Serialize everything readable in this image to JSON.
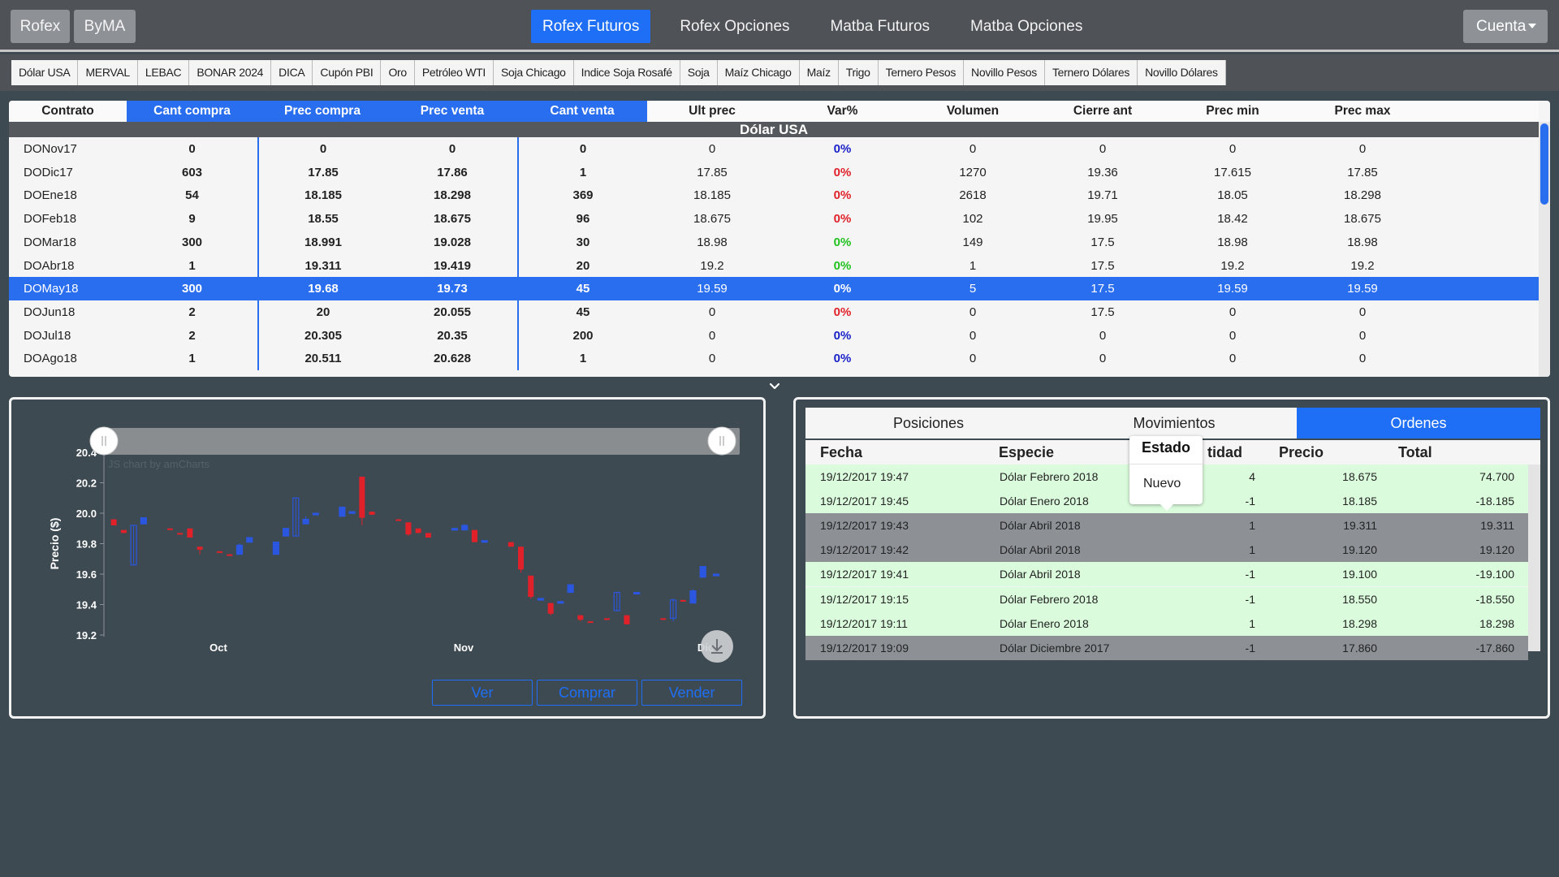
{
  "colors": {
    "page_bg": "#3d4a52",
    "nav_bg": "#4f5256",
    "accent": "#1e6ff5",
    "up": "#e0212a",
    "down": "#2a56e0",
    "var_zero": "#1a22c8",
    "var_green": "#21c11e",
    "row_green": "#dbfcdc",
    "row_gray": "#8d9196"
  },
  "topnav": {
    "markets": [
      "Rofex",
      "ByMA"
    ],
    "links": [
      {
        "label": "Rofex Futuros",
        "active": true
      },
      {
        "label": "Rofex Opciones",
        "active": false
      },
      {
        "label": "Matba Futuros",
        "active": false
      },
      {
        "label": "Matba Opciones",
        "active": false
      }
    ],
    "account_label": "Cuenta",
    "account_icon": "caret-down-icon"
  },
  "instruments": [
    "Dólar USA",
    "MERVAL",
    "LEBAC",
    "BONAR 2024",
    "DICA",
    "Cupón PBI",
    "Oro",
    "Petróleo WTI",
    "Soja Chicago",
    "Indice Soja Rosafé",
    "Soja",
    "Maíz Chicago",
    "Maíz",
    "Trigo",
    "Ternero Pesos",
    "Novillo Pesos",
    "Ternero Dólares",
    "Novillo Dólares"
  ],
  "market_table": {
    "columns": [
      "Contrato",
      "Cant compra",
      "Prec compra",
      "Prec venta",
      "Cant venta",
      "Ult prec",
      "Var%",
      "Volumen",
      "Cierre ant",
      "Prec min",
      "Prec max"
    ],
    "section_title": "Dólar USA",
    "selected_row": "DOMay18",
    "rows": [
      {
        "contrato": "DONov17",
        "cant_compra": "0",
        "prec_compra": "0",
        "prec_venta": "0",
        "cant_venta": "0",
        "ult_prec": "0",
        "var": "0%",
        "var_color": "blue",
        "volumen": "0",
        "cierre_ant": "0",
        "prec_min": "0",
        "prec_max": "0"
      },
      {
        "contrato": "DODic17",
        "cant_compra": "603",
        "prec_compra": "17.85",
        "prec_venta": "17.86",
        "cant_venta": "1",
        "ult_prec": "17.85",
        "var": "0%",
        "var_color": "red",
        "volumen": "1270",
        "cierre_ant": "19.36",
        "prec_min": "17.615",
        "prec_max": "17.85"
      },
      {
        "contrato": "DOEne18",
        "cant_compra": "54",
        "prec_compra": "18.185",
        "prec_venta": "18.298",
        "cant_venta": "369",
        "ult_prec": "18.185",
        "var": "0%",
        "var_color": "red",
        "volumen": "2618",
        "cierre_ant": "19.71",
        "prec_min": "18.05",
        "prec_max": "18.298"
      },
      {
        "contrato": "DOFeb18",
        "cant_compra": "9",
        "prec_compra": "18.55",
        "prec_venta": "18.675",
        "cant_venta": "96",
        "ult_prec": "18.675",
        "var": "0%",
        "var_color": "red",
        "volumen": "102",
        "cierre_ant": "19.95",
        "prec_min": "18.42",
        "prec_max": "18.675"
      },
      {
        "contrato": "DOMar18",
        "cant_compra": "300",
        "prec_compra": "18.991",
        "prec_venta": "19.028",
        "cant_venta": "30",
        "ult_prec": "18.98",
        "var": "0%",
        "var_color": "green",
        "volumen": "149",
        "cierre_ant": "17.5",
        "prec_min": "18.98",
        "prec_max": "18.98"
      },
      {
        "contrato": "DOAbr18",
        "cant_compra": "1",
        "prec_compra": "19.311",
        "prec_venta": "19.419",
        "cant_venta": "20",
        "ult_prec": "19.2",
        "var": "0%",
        "var_color": "green",
        "volumen": "1",
        "cierre_ant": "17.5",
        "prec_min": "19.2",
        "prec_max": "19.2"
      },
      {
        "contrato": "DOMay18",
        "cant_compra": "300",
        "prec_compra": "19.68",
        "prec_venta": "19.73",
        "cant_venta": "45",
        "ult_prec": "19.59",
        "var": "0%",
        "var_color": "green",
        "volumen": "5",
        "cierre_ant": "17.5",
        "prec_min": "19.59",
        "prec_max": "19.59"
      },
      {
        "contrato": "DOJun18",
        "cant_compra": "2",
        "prec_compra": "20",
        "prec_venta": "20.055",
        "cant_venta": "45",
        "ult_prec": "0",
        "var": "0%",
        "var_color": "red",
        "volumen": "0",
        "cierre_ant": "17.5",
        "prec_min": "0",
        "prec_max": "0"
      },
      {
        "contrato": "DOJul18",
        "cant_compra": "2",
        "prec_compra": "20.305",
        "prec_venta": "20.35",
        "cant_venta": "200",
        "ult_prec": "0",
        "var": "0%",
        "var_color": "blue",
        "volumen": "0",
        "cierre_ant": "0",
        "prec_min": "0",
        "prec_max": "0"
      },
      {
        "contrato": "DOAgo18",
        "cant_compra": "1",
        "prec_compra": "20.511",
        "prec_venta": "20.628",
        "cant_venta": "1",
        "ult_prec": "0",
        "var": "0%",
        "var_color": "blue",
        "volumen": "0",
        "cierre_ant": "0",
        "prec_min": "0",
        "prec_max": "0"
      }
    ]
  },
  "chart_panel": {
    "credit": "JS chart by amCharts",
    "scrollbar_grip_icon": "grip-lines-icon",
    "export_icon": "download-icon",
    "buttons": {
      "ver": "Ver",
      "comprar": "Comprar",
      "vender": "Vender"
    }
  },
  "chart_data": {
    "type": "candlestick",
    "ylabel": "Precio ($)",
    "ylim": [
      19.2,
      20.4
    ],
    "y_ticks": [
      "20.4",
      "20.2",
      "20.0",
      "19.8",
      "19.6",
      "19.4",
      "19.2"
    ],
    "x_ticks": [
      "Oct",
      "Nov",
      "Dic"
    ],
    "x_range_days": 92,
    "grid": false,
    "candles": [
      {
        "d": 1,
        "o": 19.96,
        "h": 19.96,
        "l": 19.92,
        "c": 19.92
      },
      {
        "d": 2.5,
        "o": 19.89,
        "h": 19.89,
        "l": 19.87,
        "c": 19.87
      },
      {
        "d": 4,
        "o": 19.66,
        "h": 19.92,
        "l": 19.66,
        "c": 19.92
      },
      {
        "d": 5.5,
        "o": 19.93,
        "h": 19.97,
        "l": 19.93,
        "c": 19.97
      },
      {
        "d": 9.5,
        "o": 19.9,
        "h": 19.9,
        "l": 19.89,
        "c": 19.89
      },
      {
        "d": 11,
        "o": 19.87,
        "h": 19.87,
        "l": 19.86,
        "c": 19.86
      },
      {
        "d": 12.5,
        "o": 19.9,
        "h": 19.9,
        "l": 19.84,
        "c": 19.84
      },
      {
        "d": 14,
        "o": 19.78,
        "h": 19.78,
        "l": 19.73,
        "c": 19.76
      },
      {
        "d": 17,
        "o": 19.75,
        "h": 19.75,
        "l": 19.74,
        "c": 19.74
      },
      {
        "d": 18.5,
        "o": 19.73,
        "h": 19.73,
        "l": 19.72,
        "c": 19.72
      },
      {
        "d": 20,
        "o": 19.73,
        "h": 19.8,
        "l": 19.73,
        "c": 19.79
      },
      {
        "d": 21.5,
        "o": 19.81,
        "h": 19.84,
        "l": 19.81,
        "c": 19.84
      },
      {
        "d": 25.5,
        "o": 19.73,
        "h": 19.81,
        "l": 19.73,
        "c": 19.81
      },
      {
        "d": 27,
        "o": 19.85,
        "h": 19.9,
        "l": 19.85,
        "c": 19.9
      },
      {
        "d": 28.5,
        "o": 19.85,
        "h": 20.1,
        "l": 19.85,
        "c": 20.1
      },
      {
        "d": 30,
        "o": 19.93,
        "h": 19.98,
        "l": 19.93,
        "c": 19.96
      },
      {
        "d": 31.5,
        "o": 20.0,
        "h": 20.0,
        "l": 20.0,
        "c": 20.0
      },
      {
        "d": 35.5,
        "o": 19.98,
        "h": 20.04,
        "l": 19.98,
        "c": 20.04
      },
      {
        "d": 37,
        "o": 20.01,
        "h": 20.01,
        "l": 20.01,
        "c": 20.01
      },
      {
        "d": 38.5,
        "o": 20.24,
        "h": 20.24,
        "l": 19.92,
        "c": 19.97
      },
      {
        "d": 40,
        "o": 20.01,
        "h": 20.01,
        "l": 19.99,
        "c": 19.99
      },
      {
        "d": 44,
        "o": 19.96,
        "h": 19.96,
        "l": 19.95,
        "c": 19.95
      },
      {
        "d": 45.5,
        "o": 19.94,
        "h": 19.94,
        "l": 19.85,
        "c": 19.86
      },
      {
        "d": 47,
        "o": 19.9,
        "h": 19.9,
        "l": 19.87,
        "c": 19.87
      },
      {
        "d": 48.5,
        "o": 19.87,
        "h": 19.87,
        "l": 19.84,
        "c": 19.84
      },
      {
        "d": 52.5,
        "o": 19.9,
        "h": 19.9,
        "l": 19.9,
        "c": 19.9
      },
      {
        "d": 54,
        "o": 19.89,
        "h": 19.93,
        "l": 19.89,
        "c": 19.92
      },
      {
        "d": 55.5,
        "o": 19.89,
        "h": 19.89,
        "l": 19.81,
        "c": 19.81
      },
      {
        "d": 57,
        "o": 19.82,
        "h": 19.82,
        "l": 19.82,
        "c": 19.82
      },
      {
        "d": 61,
        "o": 19.81,
        "h": 19.81,
        "l": 19.78,
        "c": 19.78
      },
      {
        "d": 62.5,
        "o": 19.78,
        "h": 19.78,
        "l": 19.61,
        "c": 19.63
      },
      {
        "d": 64,
        "o": 19.59,
        "h": 19.59,
        "l": 19.44,
        "c": 19.45
      },
      {
        "d": 65.5,
        "o": 19.44,
        "h": 19.44,
        "l": 19.44,
        "c": 19.44
      },
      {
        "d": 67,
        "o": 19.41,
        "h": 19.41,
        "l": 19.33,
        "c": 19.34
      },
      {
        "d": 68.5,
        "o": 19.42,
        "h": 19.42,
        "l": 19.42,
        "c": 19.42
      },
      {
        "d": 70,
        "o": 19.48,
        "h": 19.53,
        "l": 19.48,
        "c": 19.53
      },
      {
        "d": 71.5,
        "o": 19.33,
        "h": 19.33,
        "l": 19.29,
        "c": 19.3
      },
      {
        "d": 73,
        "o": 19.29,
        "h": 19.29,
        "l": 19.28,
        "c": 19.28
      },
      {
        "d": 75.5,
        "o": 19.31,
        "h": 19.31,
        "l": 19.3,
        "c": 19.3
      },
      {
        "d": 77,
        "o": 19.36,
        "h": 19.48,
        "l": 19.36,
        "c": 19.48
      },
      {
        "d": 78.5,
        "o": 19.33,
        "h": 19.33,
        "l": 19.27,
        "c": 19.27
      },
      {
        "d": 80,
        "o": 19.48,
        "h": 19.48,
        "l": 19.48,
        "c": 19.48
      },
      {
        "d": 84,
        "o": 19.31,
        "h": 19.31,
        "l": 19.3,
        "c": 19.3
      },
      {
        "d": 85.5,
        "o": 19.31,
        "h": 19.44,
        "l": 19.29,
        "c": 19.43
      },
      {
        "d": 87,
        "o": 19.43,
        "h": 19.43,
        "l": 19.42,
        "c": 19.42
      },
      {
        "d": 88.5,
        "o": 19.41,
        "h": 19.5,
        "l": 19.41,
        "c": 19.49
      },
      {
        "d": 90,
        "o": 19.58,
        "h": 19.65,
        "l": 19.58,
        "c": 19.65
      },
      {
        "d": 92,
        "o": 19.6,
        "h": 19.6,
        "l": 19.6,
        "c": 19.6
      }
    ]
  },
  "orders_panel": {
    "tabs": [
      {
        "label": "Posiciones",
        "active": false
      },
      {
        "label": "Movimientos",
        "active": false
      },
      {
        "label": "Ordenes",
        "active": true
      }
    ],
    "columns": [
      "Fecha",
      "Especie",
      "tidad",
      "Precio",
      "Total"
    ],
    "rows": [
      {
        "fecha": "19/12/2017 19:47",
        "especie": "Dólar Febrero 2018",
        "cantidad": "4",
        "precio": "18.675",
        "total": "74.700",
        "style": "green"
      },
      {
        "fecha": "19/12/2017 19:45",
        "especie": "Dólar Enero 2018",
        "cantidad": "-1",
        "precio": "18.185",
        "total": "-18.185",
        "style": "green"
      },
      {
        "fecha": "19/12/2017 19:43",
        "especie": "Dólar Abril 2018",
        "cantidad": "1",
        "precio": "19.311",
        "total": "19.311",
        "style": "gray"
      },
      {
        "fecha": "19/12/2017 19:42",
        "especie": "Dólar Abril 2018",
        "cantidad": "1",
        "precio": "19.120",
        "total": "19.120",
        "style": "gray"
      },
      {
        "fecha": "19/12/2017 19:41",
        "especie": "Dólar Abril 2018",
        "cantidad": "-1",
        "precio": "19.100",
        "total": "-19.100",
        "style": "green"
      },
      {
        "fecha": "19/12/2017 19:15",
        "especie": "Dólar Febrero 2018",
        "cantidad": "-1",
        "precio": "18.550",
        "total": "-18.550",
        "style": "green"
      },
      {
        "fecha": "19/12/2017 19:11",
        "especie": "Dólar Enero 2018",
        "cantidad": "1",
        "precio": "18.298",
        "total": "18.298",
        "style": "green"
      },
      {
        "fecha": "19/12/2017 19:09",
        "especie": "Dólar Diciembre 2017",
        "cantidad": "-1",
        "precio": "17.860",
        "total": "-17.860",
        "style": "gray"
      }
    ],
    "tooltip": {
      "title": "Estado",
      "value": "Nuevo"
    }
  },
  "collapse_icon": "chevron-down-icon"
}
